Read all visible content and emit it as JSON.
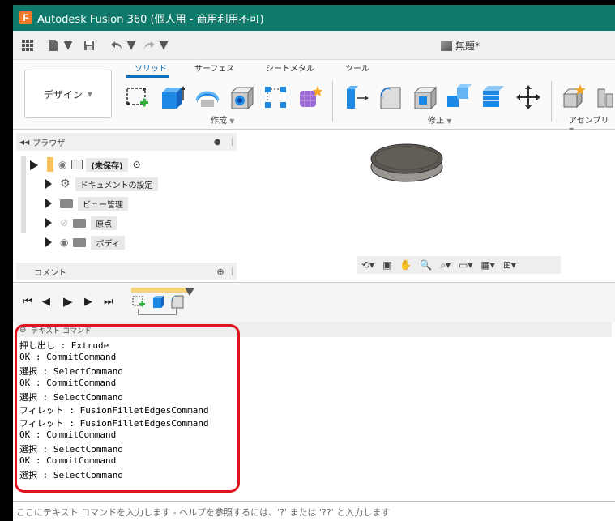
{
  "window": {
    "title": "Autodesk Fusion 360 (個人用 - 商用利用不可)",
    "logo": "F"
  },
  "document": {
    "tab_name": "無題*"
  },
  "ribbon": {
    "workspace": "デザイン",
    "tabs": [
      "ソリッド",
      "サーフェス",
      "シートメタル",
      "ツール"
    ],
    "groups": {
      "create": "作成",
      "modify": "修正",
      "assemble": "アセンブリ"
    }
  },
  "browser": {
    "title": "ブラウザ",
    "root": "(未保存)",
    "items": [
      "ドキュメントの設定",
      "ビュー管理",
      "原点",
      "ボディ"
    ]
  },
  "comments": {
    "title": "コメント"
  },
  "text_command": {
    "title": "テキスト コマンド",
    "lines": [
      "押し出し : Extrude",
      "OK : CommitCommand",
      "選択 : SelectCommand",
      "OK : CommitCommand",
      "選択 : SelectCommand",
      "フィレット : FusionFilletEdgesCommand",
      "フィレット : FusionFilletEdgesCommand",
      "OK : CommitCommand",
      "選択 : SelectCommand",
      "OK : CommitCommand",
      "選択 : SelectCommand"
    ],
    "input_placeholder": "ここにテキスト コマンドを入力します - ヘルプを参照するには、'?' または '??' と入力します"
  },
  "colors": {
    "titlebar": "#0f7a6b",
    "accent": "#0d6fbd",
    "highlight": "#e0141e"
  }
}
